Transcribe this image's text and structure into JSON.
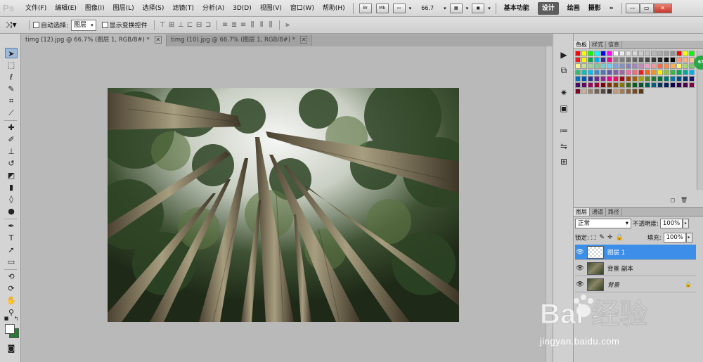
{
  "app": {
    "logo": "Ps"
  },
  "menu": [
    "文件(F)",
    "编辑(E)",
    "图像(I)",
    "图层(L)",
    "选择(S)",
    "滤镜(T)",
    "分析(A)",
    "3D(D)",
    "视图(V)",
    "窗口(W)",
    "帮助(H)"
  ],
  "menubar_buttons": [
    "Br",
    "Mb"
  ],
  "zoom": "66.7",
  "workspaces": {
    "items": [
      "基本功能",
      "设计",
      "绘画",
      "摄影"
    ],
    "active": "设计",
    "more": "»"
  },
  "window_buttons": {
    "minimize": "—",
    "restore": "▭",
    "close": "✕"
  },
  "options": {
    "auto_select_label": "自动选择:",
    "auto_select_value": "图层",
    "show_transform_label": "显示变换控件"
  },
  "tabs": [
    {
      "label": "timg (12).jpg @ 66.7% (图层 1, RGB/8#) *",
      "active": true,
      "close": "✕"
    },
    {
      "label": "timg (10).jpg @ 66.7% (图层 1, RGB/8#) *",
      "active": false,
      "close": "✕"
    }
  ],
  "panels": {
    "swatch_tabs": [
      "色板",
      "样式",
      "信息"
    ],
    "layer_tabs": [
      "图层",
      "通道",
      "路径"
    ],
    "blend_mode": "正常",
    "opacity_label": "不透明度:",
    "opacity_value": "100%",
    "lock_label": "锁定:",
    "fill_label": "填充:",
    "fill_value": "100%",
    "layers": [
      {
        "name": "图层 1",
        "selected": true,
        "thumb": "transparent"
      },
      {
        "name": "背景 副本",
        "selected": false,
        "thumb": "forest"
      },
      {
        "name": "背景",
        "selected": false,
        "thumb": "forest",
        "locked": true
      }
    ]
  },
  "badge": "67",
  "watermark": {
    "brand": "Bai 经验",
    "url": "jingyan.baidu.com"
  },
  "icons": {
    "tools": [
      "move-icon",
      "marquee-icon",
      "lasso-icon",
      "quick-select-icon",
      "crop-icon",
      "eyedropper-icon",
      "healing-icon",
      "brush-icon",
      "stamp-icon",
      "history-brush-icon",
      "eraser-icon",
      "gradient-icon",
      "blur-icon",
      "dodge-icon",
      "pen-icon",
      "type-icon",
      "path-select-icon",
      "shape-icon",
      "3d-rotate-icon",
      "3d-orbit-icon",
      "hand-icon",
      "zoom-icon"
    ],
    "dock": [
      "play-icon",
      "history-icon",
      "compass-icon",
      "image-icon",
      "adjust-icon",
      "clone-icon",
      "stamp-icon"
    ]
  }
}
